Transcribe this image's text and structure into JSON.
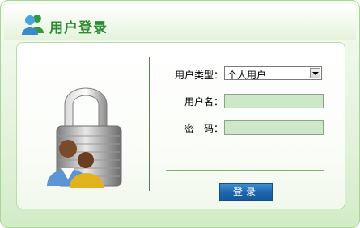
{
  "header": {
    "title": "用户登录",
    "icon": "messenger-logo-icon"
  },
  "form": {
    "user_type_label": "用户类型：",
    "user_type_value": "个人用户",
    "username_label": "用户名：",
    "username_value": "",
    "password_label": "密　码：",
    "password_value": ""
  },
  "actions": {
    "login_label": "登录"
  },
  "illustration": {
    "icon": "lock-users-icon"
  },
  "colors": {
    "title": "#2f8a36",
    "input_bg": "#cde8c8",
    "button": "#1e66b0"
  }
}
